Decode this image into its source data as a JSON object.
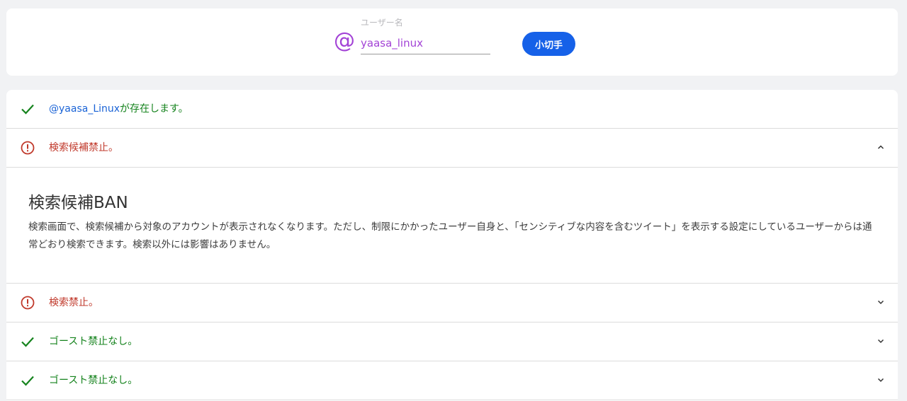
{
  "search": {
    "label": "ユーザー名",
    "value": "yaasa_linux",
    "at_symbol": "@",
    "button_label": "小切手"
  },
  "results": {
    "exists": {
      "handle": "@yaasa_Linux",
      "text": "が存在します。",
      "status": "ok"
    },
    "suggestion_ban": {
      "text": "検索候補禁止。",
      "status": "error",
      "expanded": true,
      "detail_title": "検索候補BAN",
      "detail_desc": "検索画面で、検索候補から対象のアカウントが表示されなくなります。ただし、制限にかかったユーザー自身と、「センシティブな内容を含むツイート」を表示する設定にしているユーザーからは通常どおり検索できます。検索以外には影響はありません。"
    },
    "search_ban": {
      "text": "検索禁止。",
      "status": "error",
      "expanded": false
    },
    "ghost_ban_1": {
      "text": "ゴースト禁止なし。",
      "status": "ok",
      "expanded": false
    },
    "ghost_ban_2": {
      "text": "ゴースト禁止なし。",
      "status": "ok",
      "expanded": false
    }
  },
  "colors": {
    "accent_purple": "#a343d6",
    "button_blue": "#1661e8",
    "ok_green": "#15831d",
    "error_red": "#c0392b",
    "link_blue": "#1a63d6"
  }
}
